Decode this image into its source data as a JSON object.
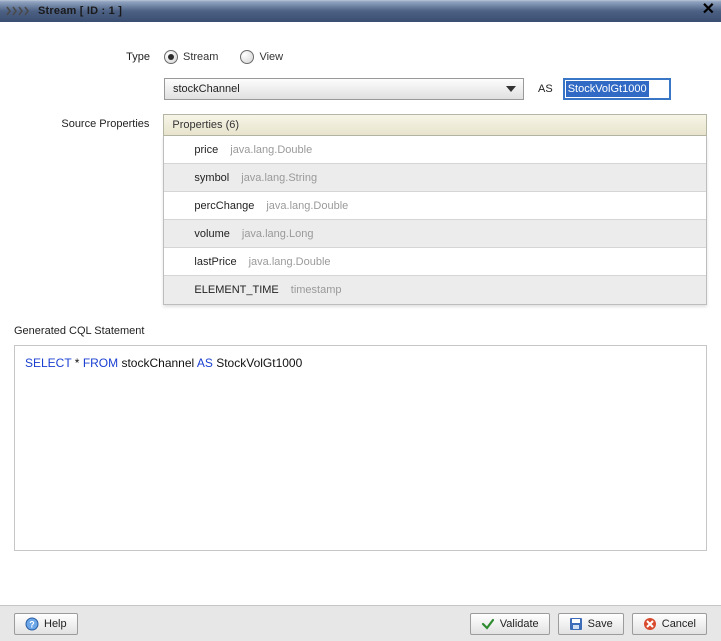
{
  "titlebar": {
    "text": "Stream [ ID : 1 ]"
  },
  "labels": {
    "type": "Type",
    "source_properties": "Source Properties",
    "as": "AS",
    "generated": "Generated CQL Statement"
  },
  "type_radio": {
    "stream": "Stream",
    "view": "View",
    "selected": "stream"
  },
  "source_dropdown": {
    "value": "stockChannel"
  },
  "as_value": "StockVolGt1000",
  "properties": {
    "header": "Properties (6)",
    "rows": [
      {
        "name": "price",
        "type": "java.lang.Double"
      },
      {
        "name": "symbol",
        "type": "java.lang.String"
      },
      {
        "name": "percChange",
        "type": "java.lang.Double"
      },
      {
        "name": "volume",
        "type": "java.lang.Long"
      },
      {
        "name": "lastPrice",
        "type": "java.lang.Double"
      },
      {
        "name": "ELEMENT_TIME",
        "type": "timestamp"
      }
    ]
  },
  "cql": {
    "select": "SELECT",
    "star_from": " * ",
    "from": "FROM",
    "source": " stockChannel  ",
    "as": "AS",
    "alias": " StockVolGt1000"
  },
  "buttons": {
    "help": "Help",
    "validate": "Validate",
    "save": "Save",
    "cancel": "Cancel"
  }
}
